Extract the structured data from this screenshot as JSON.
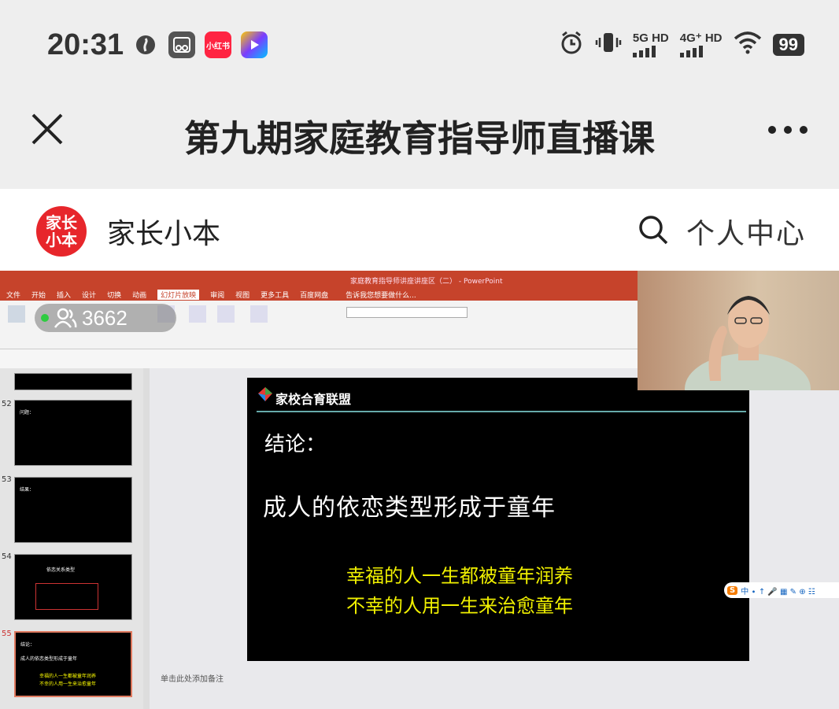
{
  "status": {
    "time": "20:31",
    "network1": "5G HD",
    "network2": "4G⁺ HD",
    "battery": "99",
    "app_icon_1": "小红书"
  },
  "header": {
    "title": "第九期家庭教育指导师直播课"
  },
  "brand": {
    "logo_text_top": "家长",
    "logo_text_bottom": "小本",
    "name": "家长小本",
    "personal_center": "个人中心"
  },
  "video": {
    "viewer_count": "3662",
    "ppt_window_title": "家庭教育指导师讲座讲座区（二） - PowerPoint",
    "ribbon_tabs": [
      "文件",
      "开始",
      "插入",
      "设计",
      "切换",
      "动画",
      "幻灯片放映",
      "审阅",
      "视图",
      "更多工具",
      "百度网盘"
    ],
    "active_tab": "幻灯片放映",
    "ribbon_search": "告诉我您想要做什么...",
    "thumbnails": [
      {
        "num": "52",
        "title": "问题："
      },
      {
        "num": "53",
        "title": "结果："
      },
      {
        "num": "54",
        "title": "依恋关系类型"
      },
      {
        "num": "55",
        "title": "结论："
      }
    ],
    "slide": {
      "logo": "家校合育联盟",
      "heading": "结论：",
      "main": "成人的依恋类型形成于童年",
      "line1": "幸福的人一生都被童年润养",
      "line2": "不幸的人用一生来治愈童年"
    },
    "notes_placeholder": "单击此处添加备注",
    "sogou_bar": "中 ∙ ↑ 🎤 ▦ ✎ ⊕ ☷"
  }
}
